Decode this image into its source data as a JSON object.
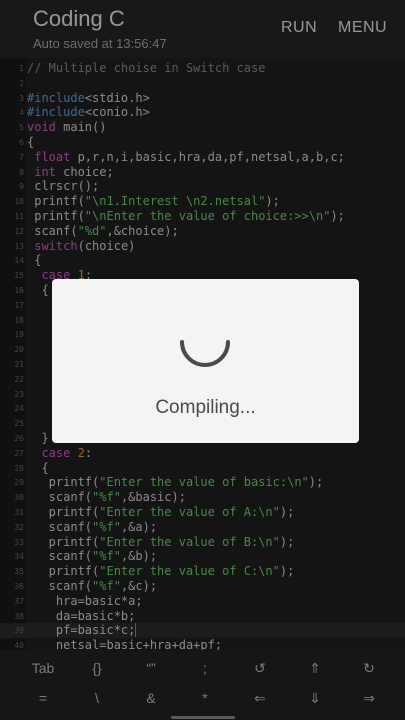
{
  "header": {
    "title": "Coding C",
    "subtitle": "Auto saved at 13:56:47",
    "run_label": "RUN",
    "menu_label": "MENU"
  },
  "dialog": {
    "message": "Compiling..."
  },
  "colors": {
    "keyword": "#d45ccf",
    "preprocessor": "#58a6e8",
    "string": "#6fd06f",
    "comment": "#8b8b8b",
    "spinner": "#4a4a4a"
  },
  "code": [
    {
      "n": "1",
      "segs": [
        [
          "comment",
          "// Multiple choise in Switch case"
        ]
      ]
    },
    {
      "n": "2",
      "segs": []
    },
    {
      "n": "3",
      "segs": [
        [
          "pre",
          "#include"
        ],
        [
          "plain",
          "<stdio.h>"
        ]
      ]
    },
    {
      "n": "4",
      "segs": [
        [
          "pre",
          "#include"
        ],
        [
          "plain",
          "<conio.h>"
        ]
      ]
    },
    {
      "n": "5",
      "segs": [
        [
          "kw",
          "void"
        ],
        [
          "plain",
          " main()"
        ]
      ]
    },
    {
      "n": "6",
      "segs": [
        [
          "plain",
          "{"
        ]
      ]
    },
    {
      "n": "7",
      "segs": [
        [
          "plain",
          " "
        ],
        [
          "kw",
          "float"
        ],
        [
          "plain",
          " p,r,n,i,basic,hra,da,pf,netsal,a,b,c;"
        ]
      ]
    },
    {
      "n": "8",
      "segs": [
        [
          "plain",
          " "
        ],
        [
          "kw",
          "int"
        ],
        [
          "plain",
          " choice;"
        ]
      ]
    },
    {
      "n": "9",
      "segs": [
        [
          "plain",
          " clrscr();"
        ]
      ]
    },
    {
      "n": "10",
      "segs": [
        [
          "plain",
          " printf("
        ],
        [
          "str",
          "\"\\n1.Interest \\n2.netsal\""
        ],
        [
          "plain",
          ");"
        ]
      ]
    },
    {
      "n": "11",
      "segs": [
        [
          "plain",
          " printf("
        ],
        [
          "str",
          "\"\\nEnter the value of choice:>>\\n\""
        ],
        [
          "plain",
          ");"
        ]
      ]
    },
    {
      "n": "12",
      "segs": [
        [
          "plain",
          " scanf("
        ],
        [
          "str",
          "\"%d\""
        ],
        [
          "plain",
          ",&choice);"
        ]
      ]
    },
    {
      "n": "13",
      "segs": [
        [
          "plain",
          " "
        ],
        [
          "kw",
          "switch"
        ],
        [
          "plain",
          "(choice)"
        ]
      ]
    },
    {
      "n": "14",
      "segs": [
        [
          "plain",
          " {"
        ]
      ]
    },
    {
      "n": "15",
      "segs": [
        [
          "plain",
          "  "
        ],
        [
          "kw",
          "case"
        ],
        [
          "plain",
          " "
        ],
        [
          "num",
          "1"
        ],
        [
          "plain",
          ":"
        ]
      ]
    },
    {
      "n": "16",
      "segs": [
        [
          "plain",
          "  {"
        ]
      ]
    },
    {
      "n": "17",
      "segs": []
    },
    {
      "n": "18",
      "segs": []
    },
    {
      "n": "19",
      "segs": []
    },
    {
      "n": "20",
      "segs": []
    },
    {
      "n": "21",
      "segs": []
    },
    {
      "n": "22",
      "segs": []
    },
    {
      "n": "23",
      "segs": []
    },
    {
      "n": "24",
      "segs": []
    },
    {
      "n": "25",
      "segs": []
    },
    {
      "n": "26",
      "segs": [
        [
          "plain",
          "  }"
        ]
      ]
    },
    {
      "n": "27",
      "segs": [
        [
          "plain",
          "  "
        ],
        [
          "kw",
          "case"
        ],
        [
          "plain",
          " "
        ],
        [
          "num",
          "2"
        ],
        [
          "plain",
          ":"
        ]
      ]
    },
    {
      "n": "28",
      "segs": [
        [
          "plain",
          "  {"
        ]
      ]
    },
    {
      "n": "29",
      "segs": [
        [
          "plain",
          "   printf("
        ],
        [
          "str",
          "\"Enter the value of basic:\\n\""
        ],
        [
          "plain",
          ");"
        ]
      ]
    },
    {
      "n": "30",
      "segs": [
        [
          "plain",
          "   scanf("
        ],
        [
          "str",
          "\"%f\""
        ],
        [
          "plain",
          ",&basic);"
        ]
      ]
    },
    {
      "n": "31",
      "segs": [
        [
          "plain",
          "   printf("
        ],
        [
          "str",
          "\"Enter the value of A:\\n\""
        ],
        [
          "plain",
          ");"
        ]
      ]
    },
    {
      "n": "32",
      "segs": [
        [
          "plain",
          "   scanf("
        ],
        [
          "str",
          "\"%f\""
        ],
        [
          "plain",
          ",&a);"
        ]
      ]
    },
    {
      "n": "33",
      "segs": [
        [
          "plain",
          "   printf("
        ],
        [
          "str",
          "\"Enter the value of B:\\n\""
        ],
        [
          "plain",
          ");"
        ]
      ]
    },
    {
      "n": "34",
      "segs": [
        [
          "plain",
          "   scanf("
        ],
        [
          "str",
          "\"%f\""
        ],
        [
          "plain",
          ",&b);"
        ]
      ]
    },
    {
      "n": "35",
      "segs": [
        [
          "plain",
          "   printf("
        ],
        [
          "str",
          "\"Enter the value of C:\\n\""
        ],
        [
          "plain",
          ");"
        ]
      ]
    },
    {
      "n": "36",
      "segs": [
        [
          "plain",
          "   scanf("
        ],
        [
          "str",
          "\"%f\""
        ],
        [
          "plain",
          ",&c);"
        ]
      ]
    },
    {
      "n": "37",
      "segs": [
        [
          "plain",
          "    hra=basic*a;"
        ]
      ]
    },
    {
      "n": "38",
      "segs": [
        [
          "plain",
          "    da=basic*b;"
        ]
      ]
    },
    {
      "n": "39",
      "segs": [
        [
          "plain",
          "    pf=basic*c;"
        ]
      ],
      "active": true
    },
    {
      "n": "40",
      "segs": [
        [
          "plain",
          "    netsal=basic+hra+da+pf;"
        ]
      ]
    }
  ],
  "keys": [
    {
      "label": "Tab",
      "icon": "tab-key"
    },
    {
      "label": "{}",
      "icon": "braces-key"
    },
    {
      "label": "“”",
      "icon": "quotes-key"
    },
    {
      "label": ";",
      "icon": "semicolon-key"
    },
    {
      "label": "↺",
      "icon": "undo-icon"
    },
    {
      "label": "⇑",
      "icon": "arrow-up-icon"
    },
    {
      "label": "↻",
      "icon": "redo-icon"
    },
    {
      "label": "=",
      "icon": "equals-key"
    },
    {
      "label": "\\",
      "icon": "backslash-key"
    },
    {
      "label": "&",
      "icon": "ampersand-key"
    },
    {
      "label": "*",
      "icon": "asterisk-key"
    },
    {
      "label": "⇐",
      "icon": "arrow-left-icon"
    },
    {
      "label": "⇓",
      "icon": "arrow-down-icon"
    },
    {
      "label": "⇒",
      "icon": "arrow-right-icon"
    }
  ]
}
